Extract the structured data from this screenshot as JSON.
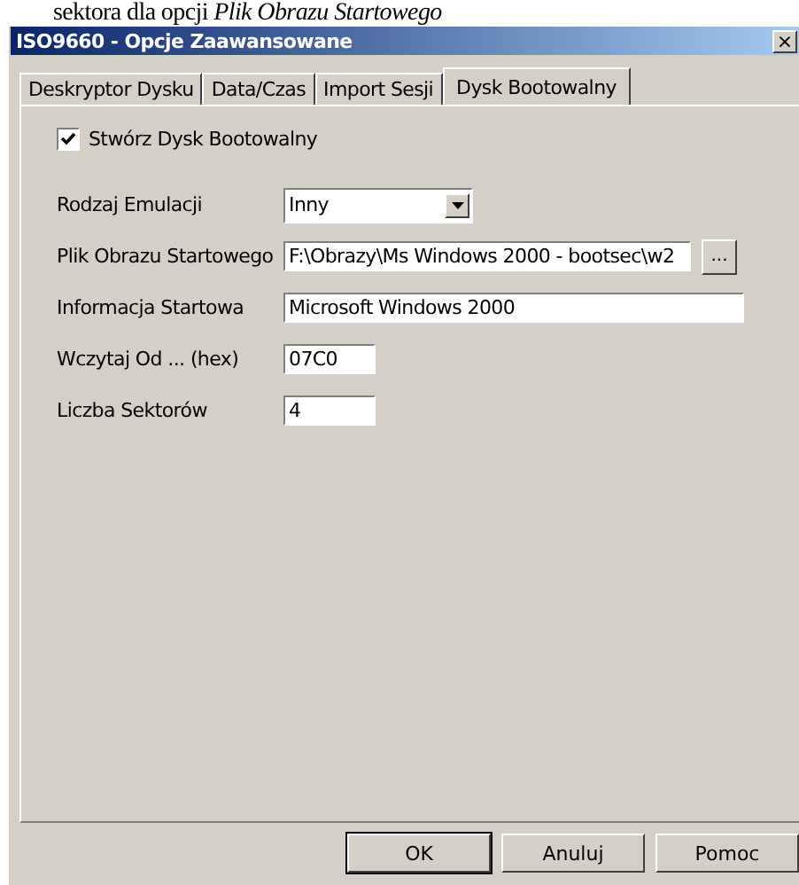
{
  "caption": "sektora dla opcji *Plik Obrazu Startowego*",
  "window": {
    "title": "ISO9660 - Opcje Zaawansowane",
    "close": "×"
  },
  "tabs": [
    {
      "label": "Deskryptor Dysku",
      "selected": false
    },
    {
      "label": "Data/Czas",
      "selected": false
    },
    {
      "label": "Import Sesji",
      "selected": false
    },
    {
      "label": "Dysk Bootowalny",
      "selected": true
    }
  ],
  "checkbox": {
    "label": "Stwórz Dysk Bootowalny",
    "checked": true
  },
  "fields": [
    {
      "kind": "dropdown",
      "label": "Rodzaj Emulacji",
      "value": "Inny"
    },
    {
      "kind": "browse",
      "label": "Plik Obrazu Startowego",
      "value": "F:\\Obrazy\\Ms Windows 2000 - bootsec\\w2",
      "button": "..."
    },
    {
      "kind": "text",
      "label": "Informacja Startowa",
      "value": "Microsoft Windows 2000"
    },
    {
      "kind": "text",
      "label": "Wczytaj Od ... (hex)",
      "value": "07C0"
    },
    {
      "kind": "text",
      "label": "Liczba Sektorów",
      "value": "4"
    }
  ],
  "buttons": [
    {
      "label": "OK",
      "default": true
    },
    {
      "label": "Anuluj",
      "default": false
    },
    {
      "label": "Pomoc",
      "default": false
    }
  ]
}
